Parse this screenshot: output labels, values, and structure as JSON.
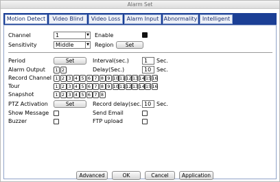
{
  "window": {
    "title": "Alarm Set"
  },
  "tabs": [
    {
      "label": "Motion Detect",
      "active": true
    },
    {
      "label": "Video Blind"
    },
    {
      "label": "Video Loss"
    },
    {
      "label": "Alarm Input"
    },
    {
      "label": "Abnormality"
    },
    {
      "label": "Intelligent"
    }
  ],
  "fields": {
    "channel": {
      "label": "Channel",
      "value": "1"
    },
    "enable": {
      "label": "Enable",
      "checked": true
    },
    "sensitivity": {
      "label": "Sensitivity",
      "value": "Middle"
    },
    "region": {
      "label": "Region",
      "button": "Set"
    },
    "period": {
      "label": "Period",
      "button": "Set"
    },
    "interval": {
      "label": "Interval(sec.)",
      "value": "1",
      "unit": "Sec."
    },
    "alarm_output": {
      "label": "Alarm Output",
      "channels": [
        "1",
        "2"
      ]
    },
    "delay": {
      "label": "Delay(Sec.)",
      "value": "10",
      "unit": "Sec."
    },
    "record_channel": {
      "label": "Record Channel",
      "channels": [
        "1",
        "2",
        "3",
        "4",
        "5",
        "6",
        "7",
        "8",
        "9",
        "10",
        "11",
        "12",
        "13",
        "14",
        "15",
        "16"
      ]
    },
    "tour": {
      "label": "Tour",
      "channels": [
        "1",
        "2",
        "3",
        "4",
        "5",
        "6",
        "7",
        "8",
        "9",
        "10",
        "11",
        "12",
        "13",
        "14",
        "15",
        "16"
      ]
    },
    "snapshot": {
      "label": "Snapshot",
      "channels": [
        "1",
        "2",
        "3",
        "4",
        "5",
        "6",
        "7",
        "8"
      ]
    },
    "ptz": {
      "label": "PTZ Activation",
      "button": "Set"
    },
    "record_delay": {
      "label": "Record delay(sec.)",
      "value": "10",
      "unit": "Sec."
    },
    "show_message": {
      "label": "Show Message",
      "checked": false
    },
    "send_email": {
      "label": "Send Email",
      "checked": false
    },
    "buzzer": {
      "label": "Buzzer",
      "checked": false
    },
    "ftp_upload": {
      "label": "FTP upload",
      "checked": false
    }
  },
  "footer": {
    "advanced": "Advanced",
    "ok": "OK",
    "cancel": "Cancel",
    "apply": "Application"
  }
}
